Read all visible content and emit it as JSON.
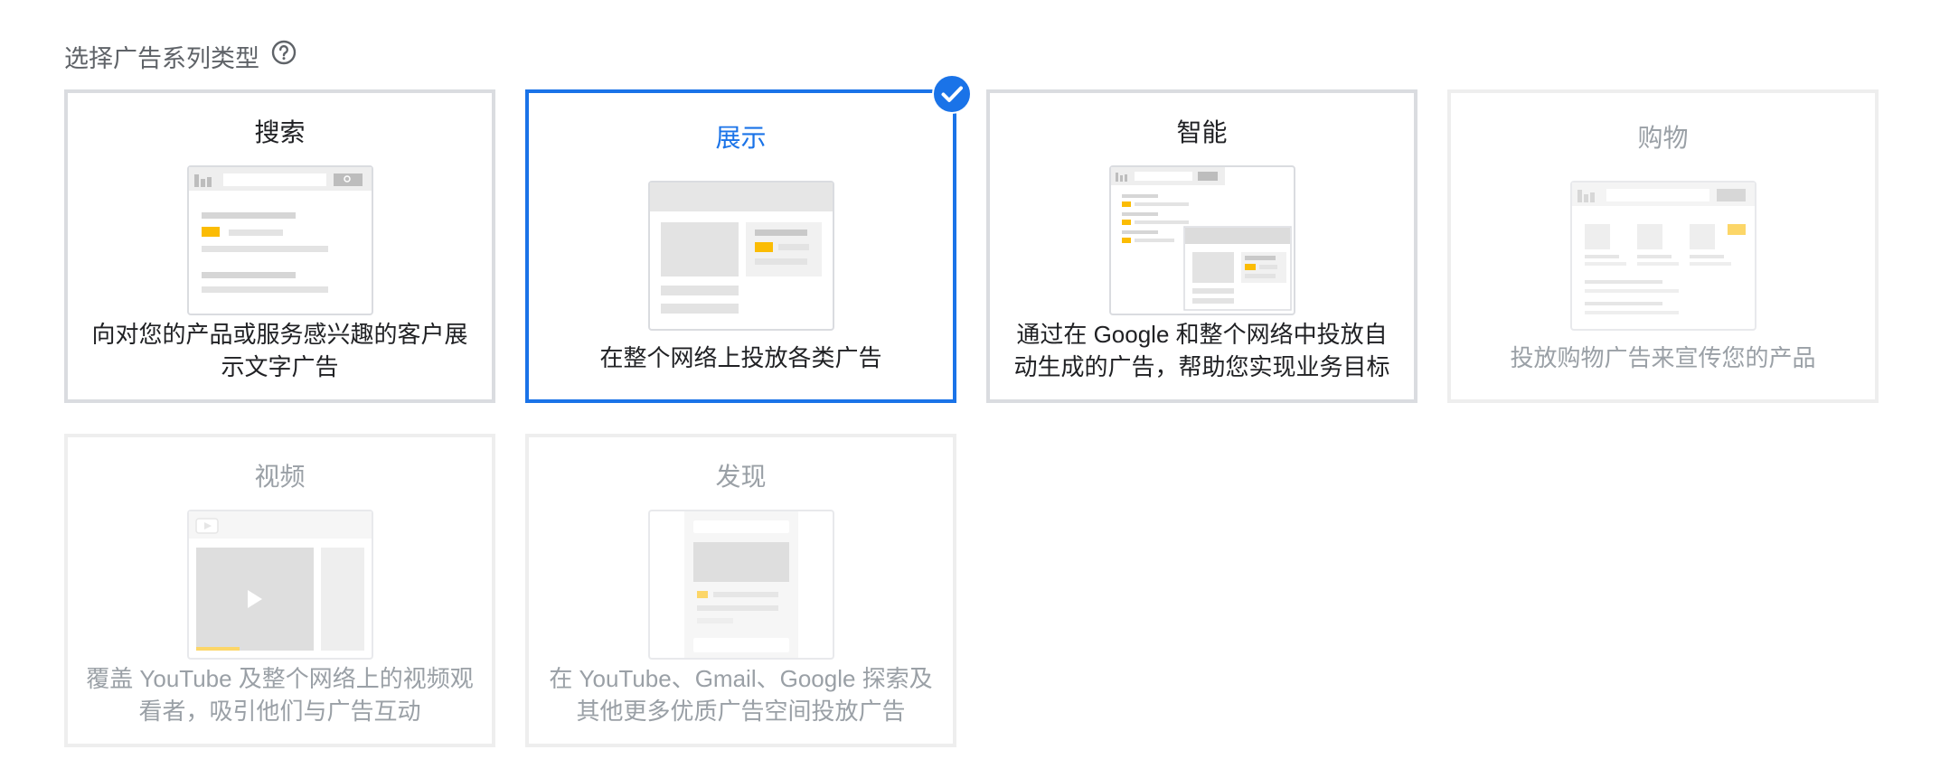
{
  "header": {
    "title": "选择广告系列类型",
    "help_icon": "help-circle-icon"
  },
  "colors": {
    "accent": "#1a73e8",
    "border": "#dadce0",
    "disabled_border": "#eeeeee",
    "yellow": "#fbbc04",
    "disabled_text": "#9aa0a6"
  },
  "cards": [
    {
      "title": "搜索",
      "desc": "向对您的产品或服务感兴趣的客户展示文字广告",
      "state": "enabled"
    },
    {
      "title": "展示",
      "desc": "在整个网络上投放各类广告",
      "state": "selected"
    },
    {
      "title": "智能",
      "desc": "通过在 Google 和整个网络中投放自动生成的广告，帮助您实现业务目标",
      "state": "enabled"
    },
    {
      "title": "购物",
      "desc": "投放购物广告来宣传您的产品",
      "state": "disabled"
    },
    {
      "title": "视频",
      "desc": "覆盖 YouTube 及整个网络上的视频观看者，吸引他们与广告互动",
      "state": "disabled"
    },
    {
      "title": "发现",
      "desc": "在 YouTube、Gmail、Google 探索及其他更多优质广告空间投放广告",
      "state": "disabled"
    }
  ]
}
